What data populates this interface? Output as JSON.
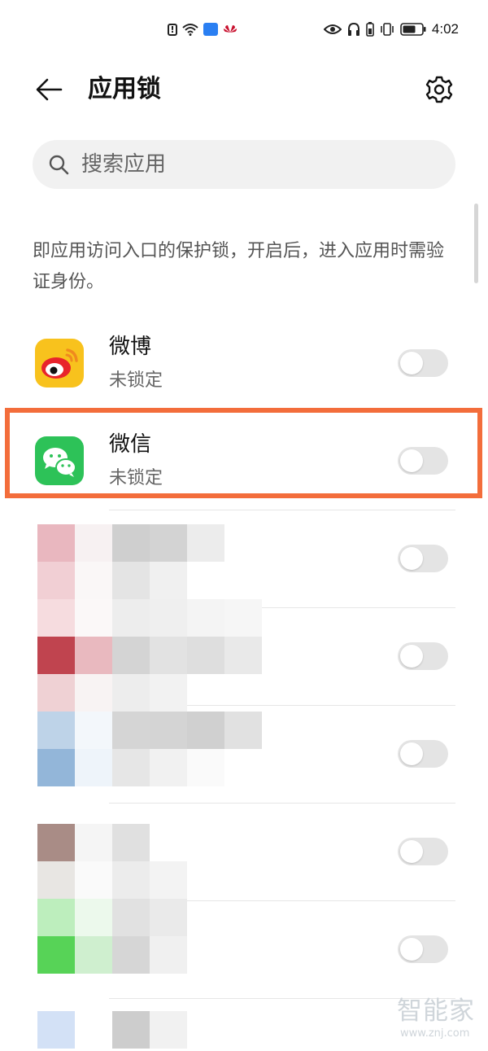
{
  "status_bar": {
    "time": "4:02"
  },
  "header": {
    "title": "应用锁"
  },
  "search": {
    "placeholder": "搜索应用"
  },
  "description": "即应用访问入口的保护锁，开启后，进入应用时需验证身份。",
  "apps": [
    {
      "name": "微博",
      "status": "未锁定",
      "locked": false
    },
    {
      "name": "微信",
      "status": "未锁定",
      "locked": false
    }
  ],
  "hidden_rows": [
    {
      "locked": false
    },
    {
      "locked": false
    },
    {
      "locked": false
    },
    {
      "locked": false
    },
    {
      "locked": false
    }
  ],
  "watermark": {
    "text": "智能家",
    "url": "www.znj.com"
  },
  "colors": {
    "highlight": "#f36d3b",
    "wechat_green": "#2dc258",
    "weibo_yellow": "#f8c21d",
    "toggle_off": "#e4e4e4"
  },
  "icons": {
    "back": "arrow-left-icon",
    "settings": "gear-icon",
    "search": "search-icon",
    "weibo": "weibo-app-icon",
    "wechat": "wechat-app-icon"
  }
}
